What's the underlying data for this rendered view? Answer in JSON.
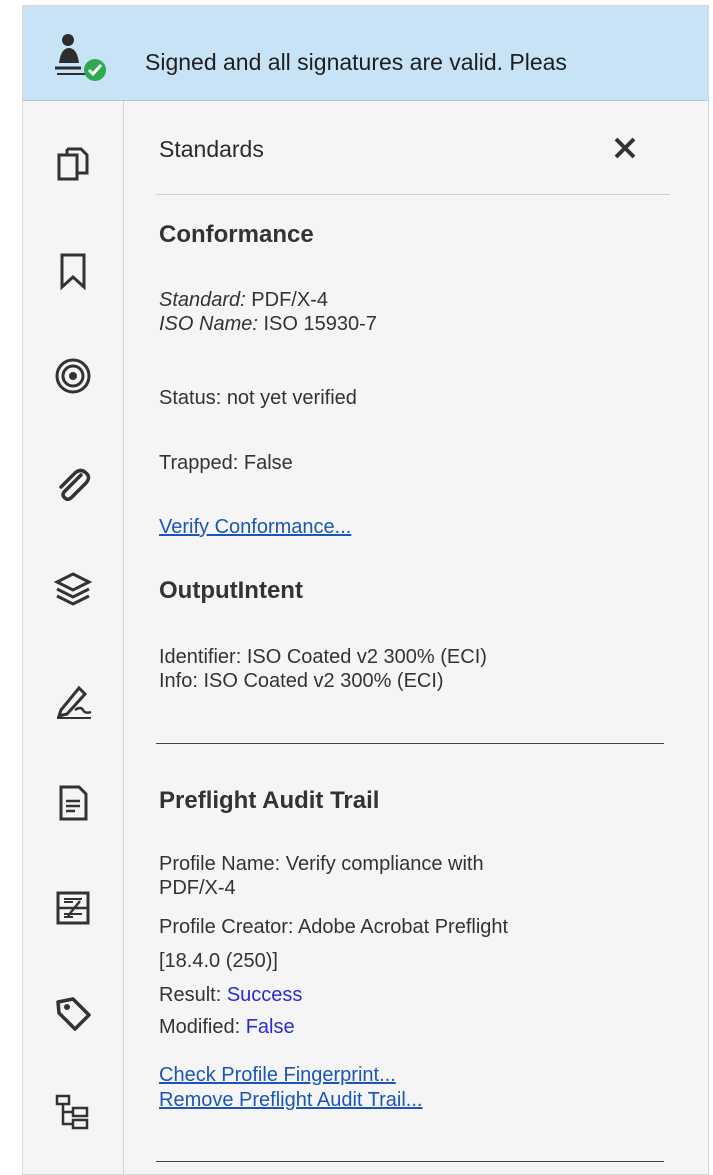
{
  "signature_bar": {
    "message": "Signed and all signatures are valid.  Pleas",
    "icon": "signature-valid-icon"
  },
  "rail": {
    "icons": [
      "pages-icon",
      "bookmark-icon",
      "target-icon",
      "attachment-icon",
      "layers-icon",
      "sign-pen-icon",
      "document-icon",
      "compare-icon",
      "tag-icon",
      "structure-tree-icon"
    ]
  },
  "panel": {
    "title": "Standards",
    "close_icon": "close-icon",
    "conformance": {
      "heading": "Conformance",
      "standard_label": "Standard:",
      "standard_value": " PDF/X-4",
      "iso_label": "ISO Name:",
      "iso_value": " ISO 15930-7",
      "status": "Status: not yet verified",
      "trapped": "Trapped: False",
      "verify_link": "Verify Conformance..."
    },
    "output_intent": {
      "heading": "OutputIntent",
      "identifier": "Identifier: ISO Coated v2 300% (ECI)",
      "info": "Info: ISO Coated v2 300% (ECI)"
    },
    "preflight": {
      "heading": "Preflight Audit Trail",
      "profile_name_1": "Profile Name: Verify compliance with",
      "profile_name_2": "PDF/X-4",
      "profile_creator_1": "Profile Creator: Adobe Acrobat Preflight",
      "profile_creator_2": "[18.4.0 (250)]",
      "result_label": "Result: ",
      "result_value": "Success",
      "modified_label": "Modified: ",
      "modified_value": "False",
      "fingerprint_link": "Check Profile Fingerprint...",
      "remove_link": "Remove Preflight Audit Trail..."
    }
  },
  "colors": {
    "signature_bar": "#c8e3f6",
    "link": "#1b55b6",
    "value": "#2a2ad0",
    "valid_badge": "#2fa84f"
  }
}
